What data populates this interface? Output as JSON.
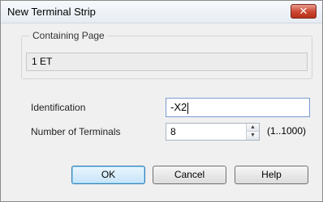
{
  "window": {
    "title": "New Terminal Strip",
    "close_glyph": "✕"
  },
  "containing_page": {
    "legend": "Containing Page",
    "value": "1 ET"
  },
  "identification": {
    "label": "Identification",
    "value": "-X2"
  },
  "terminals": {
    "label": "Number of Terminals",
    "value": "8",
    "range": "(1..1000)"
  },
  "buttons": {
    "ok": "OK",
    "cancel": "Cancel",
    "help": "Help"
  }
}
